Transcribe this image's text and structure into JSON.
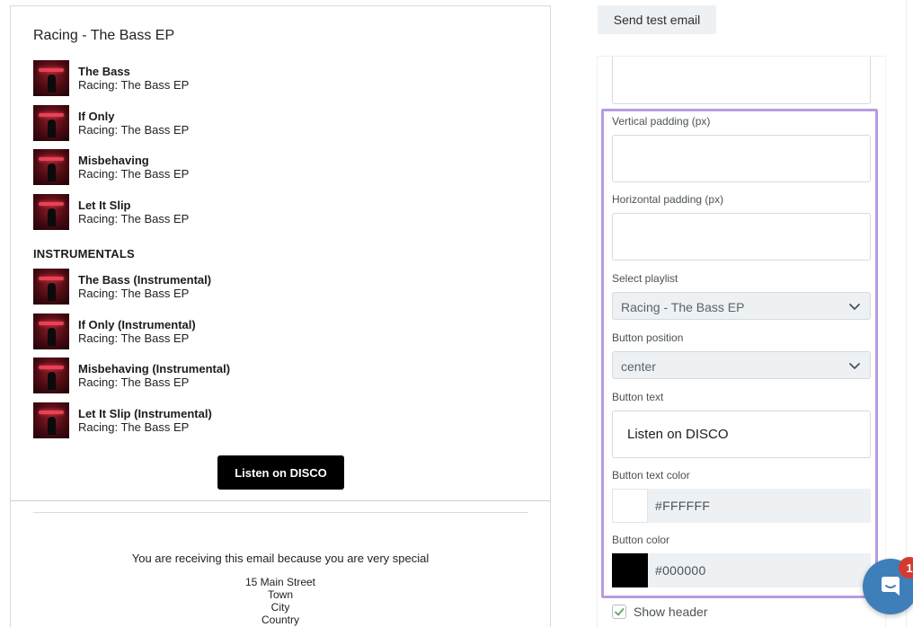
{
  "preview": {
    "playlist_title": "Racing - The Bass EP",
    "tracks": [
      {
        "name": "The Bass",
        "sub": "Racing: The Bass EP"
      },
      {
        "name": "If Only",
        "sub": "Racing: The Bass EP"
      },
      {
        "name": "Misbehaving",
        "sub": "Racing: The Bass EP"
      },
      {
        "name": "Let It Slip",
        "sub": "Racing: The Bass EP"
      }
    ],
    "section_label": "INSTRUMENTALS",
    "instrumentals": [
      {
        "name": "The Bass (Instrumental)",
        "sub": "Racing: The Bass EP"
      },
      {
        "name": "If Only (Instrumental)",
        "sub": "Racing: The Bass EP"
      },
      {
        "name": "Misbehaving (Instrumental)",
        "sub": "Racing: The Bass EP"
      },
      {
        "name": "Let It Slip (Instrumental)",
        "sub": "Racing: The Bass EP"
      }
    ],
    "button_label": "Listen on DISCO",
    "footer_message": "You are receiving this email because you are very special",
    "address": [
      "15 Main Street",
      "Town",
      "City",
      "Country"
    ]
  },
  "toolbar": {
    "send_test_label": "Send test email"
  },
  "form": {
    "vertical_padding_label": "Vertical padding (px)",
    "vertical_padding_value": "",
    "horizontal_padding_label": "Horizontal padding (px)",
    "horizontal_padding_value": "",
    "playlist_label": "Select playlist",
    "playlist_value": "Racing - The Bass EP",
    "position_label": "Button position",
    "position_value": "center",
    "button_text_label": "Button text",
    "button_text_value": "Listen on DISCO",
    "button_text_color_label": "Button text color",
    "button_text_color_value": "#FFFFFF",
    "button_color_label": "Button color",
    "button_color_value": "#000000",
    "show_header_label": "Show header",
    "show_header_checked": true
  },
  "chat": {
    "badge_count": "1",
    "icon": "chat-bubble-icon"
  },
  "colors": {
    "highlight": "#b79ce0",
    "accent": "#3e7fba",
    "check": "#5aa86a",
    "badge": "#d43a2f"
  }
}
